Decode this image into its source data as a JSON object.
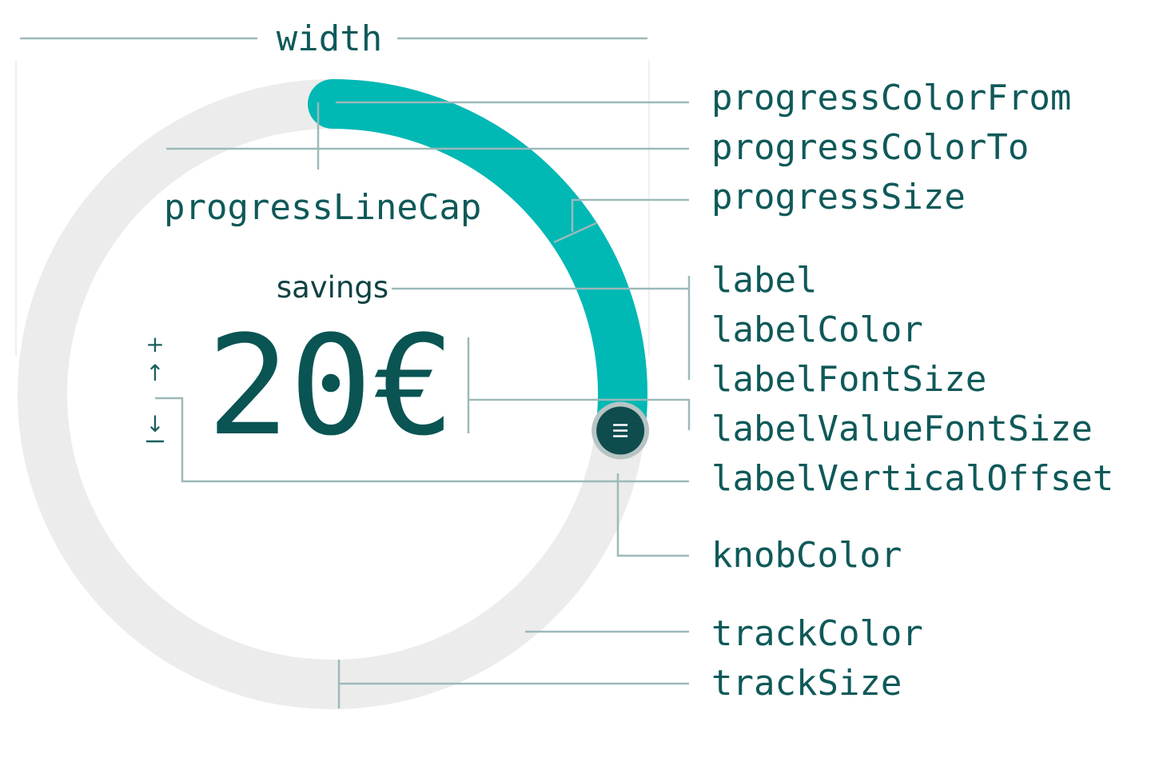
{
  "colors": {
    "progress": "#00b8b4",
    "track": "#ececec",
    "knob": "#0e4c4e",
    "knob_ring": "#b8c4c4",
    "label_text": "#0f5959",
    "leader": "#9cb9b9"
  },
  "slider": {
    "label": "savings",
    "value": "20€",
    "progress_fraction": 0.27,
    "knob_icon": "drag-handle-icon"
  },
  "offset_indicator": {
    "plus": "+",
    "up": "↑",
    "down": "↓",
    "minus": "—"
  },
  "annotations": {
    "width": "width",
    "progressColorFrom": "progressColorFrom",
    "progressColorTo": "progressColorTo",
    "progressSize": "progressSize",
    "progressLineCap": "progressLineCap",
    "label": "label",
    "labelColor": "labelColor",
    "labelFontSize": "labelFontSize",
    "labelValueFontSize": "labelValueFontSize",
    "labelVerticalOffset": "labelVerticalOffset",
    "knobColor": "knobColor",
    "trackColor": "trackColor",
    "trackSize": "trackSize"
  }
}
